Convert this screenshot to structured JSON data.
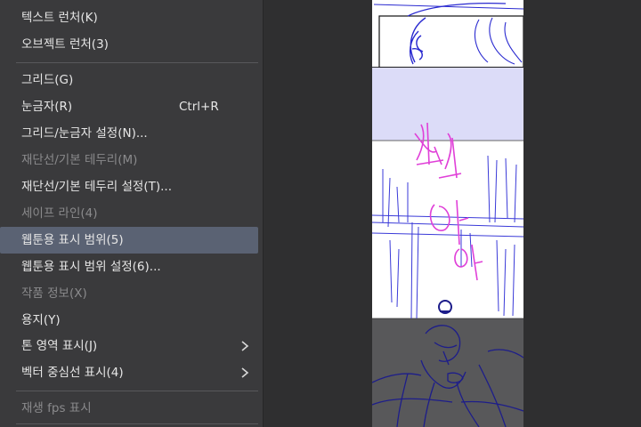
{
  "menu": {
    "items": [
      {
        "label": "텍스트 런처(K)",
        "shortcut": "",
        "disabled": false,
        "highlighted": false,
        "submenu": false
      },
      {
        "label": "오브젝트 런처(3)",
        "shortcut": "",
        "disabled": false,
        "highlighted": false,
        "submenu": false
      },
      {
        "label": "그리드(G)",
        "shortcut": "",
        "disabled": false,
        "highlighted": false,
        "submenu": false
      },
      {
        "label": "눈금자(R)",
        "shortcut": "Ctrl+R",
        "disabled": false,
        "highlighted": false,
        "submenu": false
      },
      {
        "label": "그리드/눈금자 설정(N)...",
        "shortcut": "",
        "disabled": false,
        "highlighted": false,
        "submenu": false
      },
      {
        "label": "재단선/기본 테두리(M)",
        "shortcut": "",
        "disabled": true,
        "highlighted": false,
        "submenu": false
      },
      {
        "label": "재단선/기본 테두리 설정(T)...",
        "shortcut": "",
        "disabled": false,
        "highlighted": false,
        "submenu": false
      },
      {
        "label": "세이프 라인(4)",
        "shortcut": "",
        "disabled": true,
        "highlighted": false,
        "submenu": false
      },
      {
        "label": "웹툰용 표시 범위(5)",
        "shortcut": "",
        "disabled": false,
        "highlighted": true,
        "submenu": false
      },
      {
        "label": "웹툰용 표시 범위 설정(6)...",
        "shortcut": "",
        "disabled": false,
        "highlighted": false,
        "submenu": false
      },
      {
        "label": "작품 정보(X)",
        "shortcut": "",
        "disabled": true,
        "highlighted": false,
        "submenu": false
      },
      {
        "label": "용지(Y)",
        "shortcut": "",
        "disabled": false,
        "highlighted": false,
        "submenu": false
      },
      {
        "label": "톤 영역 표시(J)",
        "shortcut": "",
        "disabled": false,
        "highlighted": false,
        "submenu": true
      },
      {
        "label": "벡터 중심선 표시(4)",
        "shortcut": "",
        "disabled": false,
        "highlighted": false,
        "submenu": true
      },
      {
        "label": "재생 fps 표시",
        "shortcut": "",
        "disabled": true,
        "highlighted": false,
        "submenu": false
      }
    ]
  },
  "canvas": {
    "strip_fill": "#ffffff",
    "display_range_fill": "#dcdcf8",
    "outside_fill": "#58585a",
    "sketch_blue": "#2a2ad0",
    "sketch_magenta": "#e040d8",
    "icons": [
      "chevron-right-icon"
    ]
  }
}
